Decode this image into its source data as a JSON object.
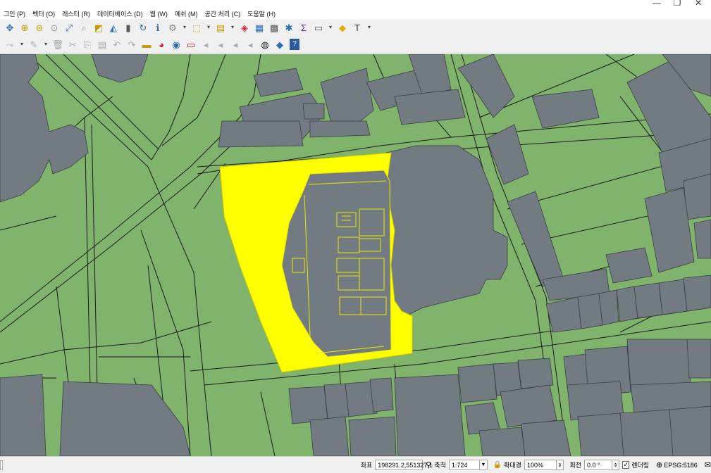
{
  "window": {
    "minimize": "—",
    "maximize": "❐",
    "close": "✕"
  },
  "menu": [
    "그인 (P)",
    "벡터 (O)",
    "래스터 (R)",
    "데이터베이스 (D)",
    "웹 (W)",
    "메쉬 (M)",
    "공간 처리 (C)",
    "도움말 (H)"
  ],
  "toolbar1": [
    {
      "name": "pan-map-icon",
      "glyph": "✥",
      "color": "#2a6fb0"
    },
    {
      "name": "zoom-in-icon",
      "glyph": "⊕",
      "color": "#c79a00"
    },
    {
      "name": "zoom-out-icon",
      "glyph": "⊖",
      "color": "#c79a00"
    },
    {
      "name": "zoom-native-icon",
      "glyph": "⊙",
      "color": "#9a9a9a"
    },
    {
      "name": "zoom-full-icon",
      "glyph": "⤢",
      "color": "#3a6fb0"
    },
    {
      "name": "zoom-selection-icon",
      "glyph": "⌕",
      "color": "#9a9a9a"
    },
    {
      "name": "zoom-layer-icon",
      "glyph": "◩",
      "color": "#c79a00"
    },
    {
      "name": "zoom-last-icon",
      "glyph": "◭",
      "color": "#2a6fb0"
    },
    {
      "name": "new-bookmark-icon",
      "glyph": "▮",
      "color": "#555"
    },
    {
      "name": "refresh-icon",
      "glyph": "↻",
      "color": "#2a6fb0"
    },
    {
      "name": "identify-icon",
      "glyph": "ℹ",
      "color": "#2a6fb0"
    },
    {
      "name": "run-action-icon",
      "glyph": "⚙",
      "color": "#888"
    },
    {
      "name": "select-features-icon",
      "glyph": "⬚",
      "color": "#c79a00"
    },
    {
      "name": "select-by-value-icon",
      "glyph": "▤",
      "color": "#c79a00"
    },
    {
      "name": "deselect-icon",
      "glyph": "◈",
      "color": "#d23"
    },
    {
      "name": "attribute-table-icon",
      "glyph": "▦",
      "color": "#2a6fb0"
    },
    {
      "name": "field-calculator-icon",
      "glyph": "▩",
      "color": "#555"
    },
    {
      "name": "processing-toolbox-icon",
      "glyph": "✱",
      "color": "#2a6fb0"
    },
    {
      "name": "statistics-icon",
      "glyph": "Σ",
      "color": "#6a1fa0"
    },
    {
      "name": "measure-icon",
      "glyph": "▭",
      "color": "#555"
    },
    {
      "name": "map-tips-icon",
      "glyph": "◆",
      "color": "#e0b000"
    },
    {
      "name": "text-annotation-icon",
      "glyph": "T",
      "color": "#333"
    }
  ],
  "toolbar2": [
    {
      "name": "digitize-icon",
      "glyph": "⤳",
      "color": "#aaa"
    },
    {
      "name": "edit-pencil-icon",
      "glyph": "✎",
      "color": "#aaa"
    },
    {
      "name": "delete-selected-icon",
      "glyph": "🗑",
      "color": "#aaa"
    },
    {
      "name": "cut-features-icon",
      "glyph": "✂",
      "color": "#aaa"
    },
    {
      "name": "copy-features-icon",
      "glyph": "⎘",
      "color": "#aaa"
    },
    {
      "name": "paste-features-icon",
      "glyph": "▤",
      "color": "#aaa"
    },
    {
      "name": "undo-icon",
      "glyph": "↶",
      "color": "#aaa"
    },
    {
      "name": "redo-icon",
      "glyph": "↷",
      "color": "#aaa"
    },
    {
      "name": "label-icon",
      "glyph": "▬",
      "color": "#c79a00"
    },
    {
      "name": "diagram-icon",
      "glyph": "◕",
      "color": "#c22"
    },
    {
      "name": "pin-label-icon",
      "glyph": "◉",
      "color": "#2a6fb0"
    },
    {
      "name": "show-labels-icon",
      "glyph": "▭",
      "color": "#c22"
    },
    {
      "name": "move-label-icon",
      "glyph": "◂",
      "color": "#aaa"
    },
    {
      "name": "rotate-label-icon",
      "glyph": "◂",
      "color": "#aaa"
    },
    {
      "name": "change-label-icon",
      "glyph": "◂",
      "color": "#aaa"
    },
    {
      "name": "change-label2-icon",
      "glyph": "◂",
      "color": "#aaa"
    },
    {
      "name": "globe-plugin-icon",
      "glyph": "◍",
      "color": "#222"
    },
    {
      "name": "python-console-icon",
      "glyph": "◆",
      "color": "#2a6fb0"
    },
    {
      "name": "help-icon",
      "glyph": "?",
      "color": "#fff"
    }
  ],
  "status": {
    "coord_label": "좌표",
    "coord_value": "198291.2,551327.1",
    "scale_label": "축척",
    "scale_value": "1:724",
    "magnifier_label": "확대경",
    "magnifier_value": "100%",
    "rotation_label": "회전",
    "rotation_value": "0.0 °",
    "render_label": "렌더링",
    "crs_label": "EPSG:5186"
  },
  "colors": {
    "land": "#80b36b",
    "building": "#727a82",
    "selection": "#ffff00",
    "selected_outline": "#e8e800",
    "line": "#1a1a1a"
  }
}
